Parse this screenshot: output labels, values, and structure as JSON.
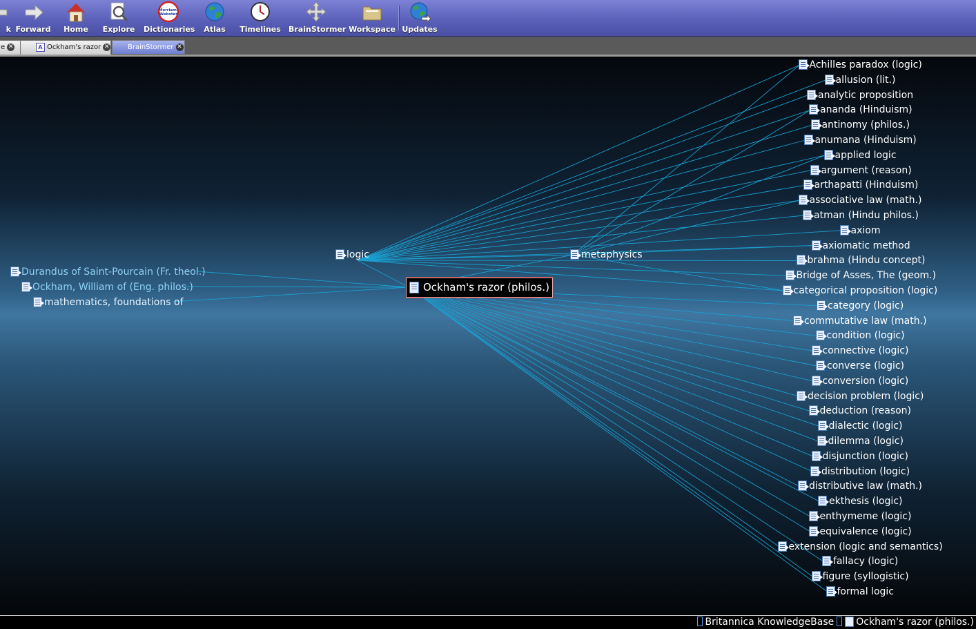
{
  "toolbar": {
    "items": [
      {
        "label": "k",
        "icon": "back-arrow-icon"
      },
      {
        "label": "Forward",
        "icon": "forward-arrow-icon"
      },
      {
        "label": "Home",
        "icon": "home-icon"
      },
      {
        "label": "Explore",
        "icon": "explore-magnifier-icon"
      },
      {
        "label": "Dictionaries",
        "icon": "merriam-webster-icon",
        "icon_text": "Merriam-Webster"
      },
      {
        "label": "Atlas",
        "icon": "globe-icon"
      },
      {
        "label": "Timelines",
        "icon": "clock-icon"
      },
      {
        "label": "BrainStormer",
        "icon": "move-arrows-icon"
      },
      {
        "label": "Workspace",
        "icon": "folder-icon"
      },
      {
        "label": "Updates",
        "icon": "globe-arrow-icon"
      }
    ]
  },
  "tabs": [
    {
      "label": "e",
      "active": false
    },
    {
      "label": "Ockham's razor",
      "active": false,
      "icon": "article-a-icon"
    },
    {
      "label": "BrainStormer",
      "active": true
    }
  ],
  "brainstormer": {
    "center": "Ockham's razor (philos.)",
    "hubs": [
      "logic",
      "metaphysics"
    ],
    "left_nodes": [
      "Durandus of Saint-Pourcain (Fr. theol.)",
      "Ockham, William of (Eng. philos.)",
      "mathematics, foundations of"
    ],
    "right_nodes": [
      "Achilles paradox (logic)",
      "allusion (lit.)",
      "analytic proposition",
      "ananda (Hinduism)",
      "antinomy (philos.)",
      "anumana (Hinduism)",
      "applied logic",
      "argument (reason)",
      "arthapatti (Hinduism)",
      "associative law (math.)",
      "atman (Hindu philos.)",
      "axiom",
      "axiomatic method",
      "brahma (Hindu concept)",
      "Bridge of Asses, The (geom.)",
      "categorical proposition (logic)",
      "category (logic)",
      "commutative law (math.)",
      "condition (logic)",
      "connective (logic)",
      "converse (logic)",
      "conversion (logic)",
      "decision problem (logic)",
      "deduction (reason)",
      "dialectic (logic)",
      "dilemma (logic)",
      "disjunction (logic)",
      "distribution (logic)",
      "distributive law (math.)",
      "ekthesis (logic)",
      "enthymeme (logic)",
      "equivalence (logic)",
      "extension (logic and semantics)",
      "fallacy (logic)",
      "figure (syllogistic)",
      "formal logic"
    ]
  },
  "status": {
    "source": "Britannica KnowledgeBase",
    "current": "Ockham's razor (philos.)"
  },
  "colors": {
    "link_line": "#1a9fd0",
    "toolbar_bg": "#5b61b9",
    "center_border": "#b03030"
  }
}
